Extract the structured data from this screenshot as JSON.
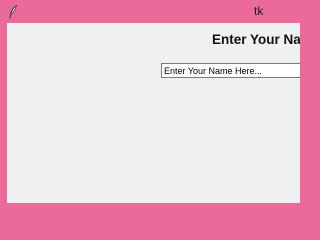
{
  "window": {
    "title": "tk",
    "title_bar_color": "#ec6a9a",
    "client_bg_color": "#f0f0f0",
    "app_icon": "feather-icon"
  },
  "main": {
    "heading": "Enter Your Name",
    "entry_value": "Enter Your Name Here..."
  }
}
